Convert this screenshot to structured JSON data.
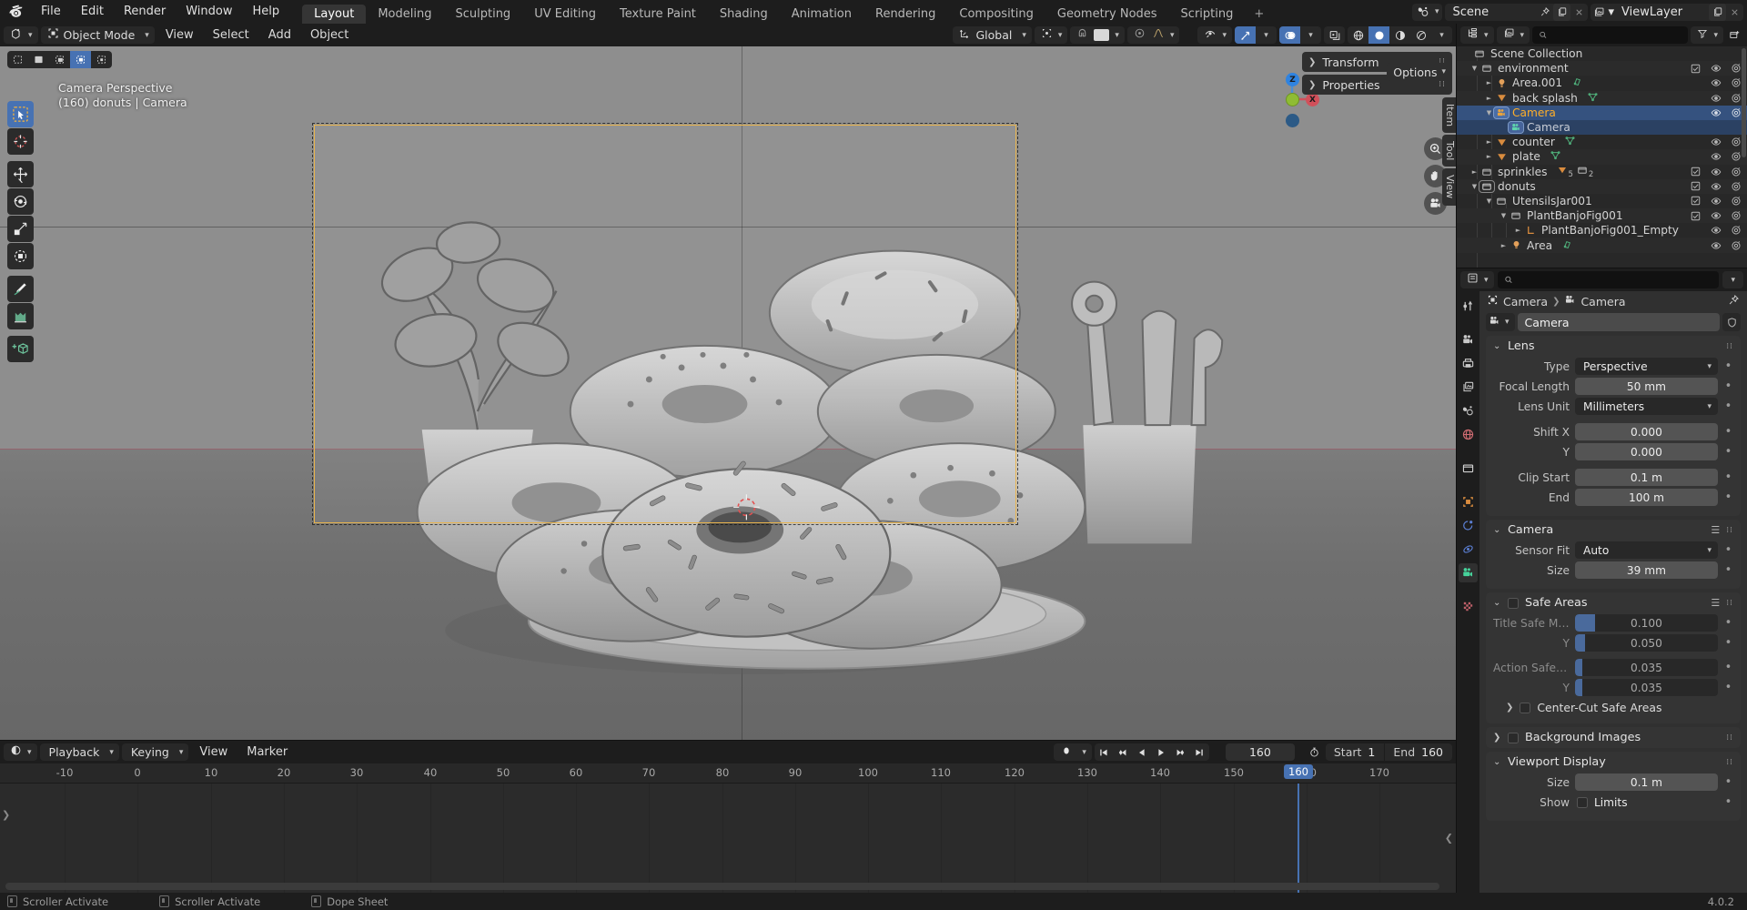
{
  "app": {
    "name": "Blender",
    "version": "4.0.2",
    "logo_name": "blender-logo"
  },
  "topbar": {
    "menus": [
      "File",
      "Edit",
      "Render",
      "Window",
      "Help"
    ],
    "workspace_tabs": [
      {
        "label": "Layout",
        "active": true
      },
      {
        "label": "Modeling",
        "active": false
      },
      {
        "label": "Sculpting",
        "active": false
      },
      {
        "label": "UV Editing",
        "active": false
      },
      {
        "label": "Texture Paint",
        "active": false
      },
      {
        "label": "Shading",
        "active": false
      },
      {
        "label": "Animation",
        "active": false
      },
      {
        "label": "Rendering",
        "active": false
      },
      {
        "label": "Compositing",
        "active": false
      },
      {
        "label": "Geometry Nodes",
        "active": false
      },
      {
        "label": "Scripting",
        "active": false
      }
    ],
    "add_workspace_label": "+",
    "scene_label": "Scene",
    "viewlayer_label": "ViewLayer"
  },
  "viewport": {
    "header": {
      "mode": "Object Mode",
      "menus": [
        "View",
        "Select",
        "Add",
        "Object"
      ],
      "transform_orientation": "Global",
      "select_modes": [
        "tweak",
        "box",
        "circle",
        "lasso",
        "select-box-active"
      ]
    },
    "overlay": {
      "view_name": "Camera Perspective",
      "scene_info": "(160) donuts | Camera"
    },
    "toolbar_tools": [
      {
        "name": "tweak-select-tool",
        "active": true
      },
      {
        "name": "cursor-tool",
        "active": false
      },
      {
        "name": "move-tool",
        "active": false
      },
      {
        "name": "rotate-tool",
        "active": false
      },
      {
        "name": "scale-tool",
        "active": false
      },
      {
        "name": "transform-tool",
        "active": false
      },
      {
        "name": "annotate-tool",
        "active": false
      },
      {
        "name": "measure-tool",
        "active": false
      },
      {
        "name": "add-cube-tool",
        "active": false
      }
    ],
    "gizmo_axes": [
      "Z",
      "X",
      "Y"
    ],
    "side_panel": {
      "rows": [
        "Transform",
        "Properties"
      ],
      "options_label": "Options",
      "vtabs": [
        "Item",
        "Tool",
        "View"
      ]
    }
  },
  "timeline": {
    "header": {
      "editor_label": "timeline-editor",
      "menus": [
        "Playback",
        "Keying",
        "View",
        "Marker"
      ],
      "current_frame": "160",
      "start_label": "Start",
      "start_value": "1",
      "end_label": "End",
      "end_value": "160"
    },
    "ruler_ticks": [
      "-10",
      "0",
      "10",
      "20",
      "30",
      "40",
      "50",
      "60",
      "70",
      "80",
      "90",
      "100",
      "110",
      "120",
      "130",
      "140",
      "150",
      "160",
      "170"
    ],
    "playhead_frame": "160"
  },
  "outliner": {
    "search_placeholder": "",
    "rows": [
      {
        "indent": 0,
        "arrow": "",
        "icon": "collection-icon",
        "name": "Scene Collection",
        "state": "normal",
        "checkbox": false,
        "eye": false,
        "camera": false
      },
      {
        "indent": 1,
        "arrow": "▼",
        "icon": "collection-icon",
        "name": "environment",
        "state": "normal",
        "checkbox": true,
        "eye": true,
        "camera": true
      },
      {
        "indent": 2,
        "arrow": "►",
        "icon": "light-icon",
        "name": "Area.001",
        "state": "normal",
        "checkbox": false,
        "eye": true,
        "camera": true,
        "data_icon": "light-data-icon"
      },
      {
        "indent": 2,
        "arrow": "►",
        "icon": "mesh-icon",
        "name": "back splash",
        "state": "normal",
        "checkbox": false,
        "eye": true,
        "camera": true,
        "data_icon": "mesh-data-icon"
      },
      {
        "indent": 2,
        "arrow": "▼",
        "icon": "camera-icon",
        "name": "Camera",
        "state": "active",
        "checkbox": false,
        "eye": true,
        "camera": true
      },
      {
        "indent": 3,
        "arrow": "",
        "icon": "camera-data-icon",
        "name": "Camera",
        "state": "selected",
        "checkbox": false,
        "eye": false,
        "camera": false
      },
      {
        "indent": 2,
        "arrow": "►",
        "icon": "mesh-icon",
        "name": "counter",
        "state": "normal",
        "checkbox": false,
        "eye": true,
        "camera": true,
        "data_icon": "mesh-data-icon"
      },
      {
        "indent": 2,
        "arrow": "►",
        "icon": "mesh-icon",
        "name": "plate",
        "state": "normal",
        "checkbox": false,
        "eye": true,
        "camera": true,
        "data_icon": "mesh-data-icon"
      },
      {
        "indent": 1,
        "arrow": "►",
        "icon": "collection-icon",
        "name": "sprinkles",
        "state": "normal",
        "checkbox": true,
        "eye": true,
        "camera": true,
        "badge_mesh": "5",
        "badge_coll": "2"
      },
      {
        "indent": 1,
        "arrow": "▼",
        "icon": "collection-icon",
        "name": "donuts",
        "state": "normal",
        "checkbox": true,
        "eye": true,
        "camera": true
      },
      {
        "indent": 2,
        "arrow": "▼",
        "icon": "collection-icon",
        "name": "UtensilsJar001",
        "state": "normal",
        "checkbox": true,
        "eye": true,
        "camera": true
      },
      {
        "indent": 3,
        "arrow": "▼",
        "icon": "collection-icon",
        "name": "PlantBanjoFig001",
        "state": "normal",
        "checkbox": true,
        "eye": true,
        "camera": true
      },
      {
        "indent": 4,
        "arrow": "►",
        "icon": "empty-icon",
        "name": "PlantBanjoFig001_Empty",
        "state": "normal",
        "checkbox": false,
        "eye": true,
        "camera": true
      },
      {
        "indent": 3,
        "arrow": "►",
        "icon": "light-icon",
        "name": "Area",
        "state": "normal",
        "checkbox": false,
        "eye": true,
        "camera": true,
        "data_icon": "light-data-icon"
      }
    ]
  },
  "properties": {
    "search_placeholder": "",
    "breadcrumb": [
      "Camera",
      "Camera"
    ],
    "id_name": "Camera",
    "tabs": [
      {
        "name": "tool-tab",
        "active": false
      },
      {
        "name": "render-tab",
        "active": false
      },
      {
        "name": "output-tab",
        "active": false
      },
      {
        "name": "view-layer-tab",
        "active": false
      },
      {
        "name": "scene-tab",
        "active": false
      },
      {
        "name": "world-tab",
        "active": false
      },
      {
        "name": "collection-tab",
        "active": false
      },
      {
        "name": "object-tab",
        "active": false
      },
      {
        "name": "modifiers-tab",
        "active": false
      },
      {
        "name": "physics-tab",
        "active": false
      },
      {
        "name": "object-data-camera-tab",
        "active": true
      },
      {
        "name": "material-tab",
        "active": false
      }
    ],
    "panels": [
      {
        "title": "Lens",
        "open": true,
        "fields": [
          {
            "label": "Type",
            "value": "Perspective",
            "kind": "dropdown"
          },
          {
            "label": "Focal Length",
            "value": "50 mm",
            "kind": "num"
          },
          {
            "label": "Lens Unit",
            "value": "Millimeters",
            "kind": "dropdown"
          },
          {
            "label": "Shift X",
            "value": "0.000",
            "kind": "num"
          },
          {
            "label": "Y",
            "value": "0.000",
            "kind": "num"
          },
          {
            "label": "Clip Start",
            "value": "0.1 m",
            "kind": "num"
          },
          {
            "label": "End",
            "value": "100 m",
            "kind": "num"
          }
        ]
      },
      {
        "title": "Camera",
        "open": true,
        "has_list_icon": true,
        "fields": [
          {
            "label": "Sensor Fit",
            "value": "Auto",
            "kind": "dropdown"
          },
          {
            "label": "Size",
            "value": "39 mm",
            "kind": "num"
          }
        ]
      },
      {
        "title": "Safe Areas",
        "open": true,
        "checkbox": false,
        "has_list_icon": true,
        "fields": [
          {
            "label": "Title Safe Margi…",
            "value": "0.100",
            "kind": "slider",
            "fill": 14,
            "dim": true
          },
          {
            "label": "Y",
            "value": "0.050",
            "kind": "slider",
            "fill": 7,
            "dim": true
          },
          {
            "label": "Action Safe Mar…",
            "value": "0.035",
            "kind": "slider",
            "fill": 5,
            "dim": true
          },
          {
            "label": "Y",
            "value": "0.035",
            "kind": "slider",
            "fill": 5,
            "dim": true
          }
        ],
        "subpanel": {
          "label": "Center-Cut Safe Areas",
          "arrow": "›",
          "checkbox": false
        }
      },
      {
        "title": "Background Images",
        "open": false,
        "checkbox": false,
        "fields": []
      },
      {
        "title": "Viewport Display",
        "open": true,
        "fields": [
          {
            "label": "Size",
            "value": "0.1 m",
            "kind": "num"
          }
        ],
        "check_row": {
          "label": "Show",
          "value": "Limits",
          "checked": false
        }
      }
    ]
  },
  "statusbar": {
    "items": [
      "Scroller Activate",
      "Scroller Activate",
      "Dope Sheet"
    ],
    "version": "4.0.2"
  },
  "colors": {
    "accent_blue": "#4772b3",
    "active_object_orange": "#ffaf29",
    "camera_frame": "#e9b44c",
    "panel_bg": "#303030",
    "editor_bg": "#1d1d1d"
  }
}
